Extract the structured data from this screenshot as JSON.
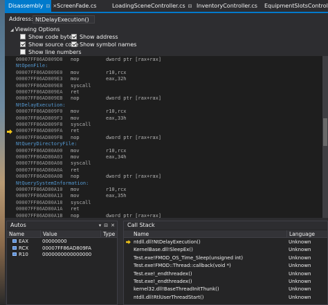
{
  "tabs": [
    {
      "label": "Disassembly",
      "active": true,
      "pin": "⊟",
      "close": "✕"
    },
    {
      "label": "ScreenFade.cs",
      "active": false
    },
    {
      "label": "LoadingSceneController.cs",
      "active": false,
      "pin": "⊟"
    },
    {
      "label": "InventoryController.cs",
      "active": false
    },
    {
      "label": "EquipmentSlotsController.cs",
      "active": false
    }
  ],
  "address": {
    "label": "Address:",
    "value": "NtDelayExecution()"
  },
  "view_options": {
    "header": "Viewing Options",
    "options": [
      {
        "label": "Show code bytes",
        "checked": false
      },
      {
        "label": "Show address",
        "checked": true
      },
      {
        "label": "Show source code",
        "checked": true
      },
      {
        "label": "Show symbol names",
        "checked": true
      },
      {
        "label": "Show line numbers",
        "checked": false
      }
    ]
  },
  "disassembly": [
    {
      "addr": "00007FF86AD809D8",
      "mn": "nop",
      "op": "dword ptr [rax+rax]"
    },
    {
      "sym": "NtOpenFile:"
    },
    {
      "addr": "00007FF86AD809E0",
      "mn": "mov",
      "op": "r10,rcx"
    },
    {
      "addr": "00007FF86AD809E3",
      "mn": "mov",
      "op": "eax,32h"
    },
    {
      "addr": "00007FF86AD809E8",
      "mn": "syscall",
      "op": ""
    },
    {
      "addr": "00007FF86AD809EA",
      "mn": "ret",
      "op": ""
    },
    {
      "addr": "00007FF86AD809EB",
      "mn": "nop",
      "op": "dword ptr [rax+rax]"
    },
    {
      "sym": "NtDelayExecution:"
    },
    {
      "addr": "00007FF86AD809F0",
      "mn": "mov",
      "op": "r10,rcx"
    },
    {
      "addr": "00007FF86AD809F3",
      "mn": "mov",
      "op": "eax,33h"
    },
    {
      "addr": "00007FF86AD809F8",
      "mn": "syscall",
      "op": ""
    },
    {
      "addr": "00007FF86AD809FA",
      "mn": "ret",
      "op": "",
      "current": true
    },
    {
      "addr": "00007FF86AD809FB",
      "mn": "nop",
      "op": "dword ptr [rax+rax]"
    },
    {
      "sym": "NtQueryDirectoryFile:"
    },
    {
      "addr": "00007FF86AD80A00",
      "mn": "mov",
      "op": "r10,rcx"
    },
    {
      "addr": "00007FF86AD80A03",
      "mn": "mov",
      "op": "eax,34h"
    },
    {
      "addr": "00007FF86AD80A08",
      "mn": "syscall",
      "op": ""
    },
    {
      "addr": "00007FF86AD80A0A",
      "mn": "ret",
      "op": ""
    },
    {
      "addr": "00007FF86AD80A0B",
      "mn": "nop",
      "op": "dword ptr [rax+rax]"
    },
    {
      "sym": "NtQuerySystemInformation:"
    },
    {
      "addr": "00007FF86AD80A10",
      "mn": "mov",
      "op": "r10,rcx"
    },
    {
      "addr": "00007FF86AD80A13",
      "mn": "mov",
      "op": "eax,35h"
    },
    {
      "addr": "00007FF86AD80A18",
      "mn": "syscall",
      "op": ""
    },
    {
      "addr": "00007FF86AD80A1A",
      "mn": "ret",
      "op": ""
    },
    {
      "addr": "00007FF86AD80A1B",
      "mn": "nop",
      "op": "dword ptr [rax+rax]"
    }
  ],
  "autos": {
    "title": "Autos",
    "buttons": [
      "▾",
      "⊟",
      "✕"
    ],
    "columns": [
      "Name",
      "Value",
      "Type"
    ],
    "rows": [
      {
        "name": "EAX",
        "value": "00000000",
        "type": ""
      },
      {
        "name": "RCX",
        "value": "00007FF86AD809FA",
        "type": ""
      },
      {
        "name": "R10",
        "value": "0000000000000000",
        "type": ""
      }
    ]
  },
  "call_stack": {
    "title": "Call Stack",
    "columns": [
      "Name",
      "Language"
    ],
    "rows": [
      {
        "name": "ntdll.dll!NtDelayExecution()",
        "lang": "Unknown",
        "current": true
      },
      {
        "name": "KernelBase.dll!SleepEx()",
        "lang": "Unknown"
      },
      {
        "name": "Test.exe!FMOD_OS_Time_Sleep(unsigned int)",
        "lang": "Unknown"
      },
      {
        "name": "Test.exe!FMOD::Thread::callback(void *)",
        "lang": "Unknown"
      },
      {
        "name": "Test.exe!_endthreadex()",
        "lang": "Unknown"
      },
      {
        "name": "Test.exe!_endthreadex()",
        "lang": "Unknown"
      },
      {
        "name": "kernel32.dll!BaseThreadInitThunk()",
        "lang": "Unknown"
      },
      {
        "name": "ntdll.dll!RtlUserThreadStart()",
        "lang": "Unknown"
      }
    ]
  },
  "colors": {
    "accent": "#007acc",
    "background": "#1e1e1e",
    "symbol": "#569cd6",
    "current_arrow": "#f0c419"
  }
}
